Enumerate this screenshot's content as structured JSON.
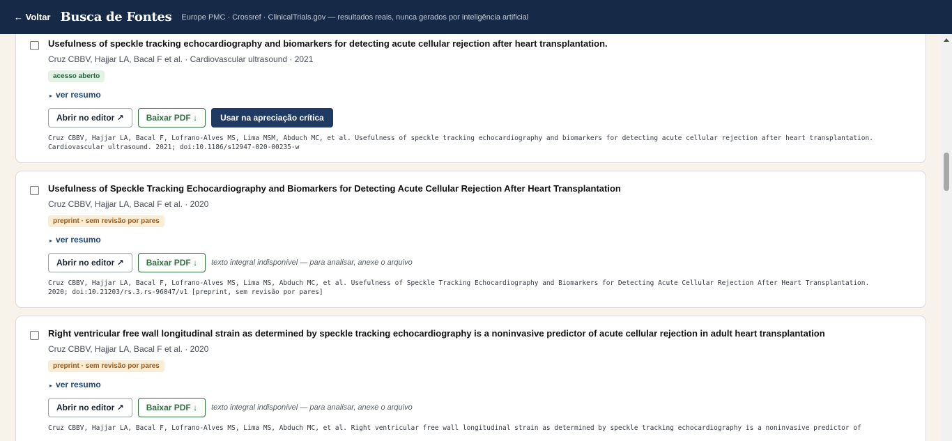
{
  "header": {
    "back_label": "← Voltar",
    "brand": "Busca de Fontes",
    "subtitle": "Europe PMC · Crossref · ClinicalTrials.gov — resultados reais, nunca gerados por inteligência artificial"
  },
  "common": {
    "ver_resumo": "ver resumo",
    "abrir_editor": "Abrir no editor ↗",
    "baixar_pdf": "Baixar PDF ↓",
    "usar_apreciacao": "Usar na apreciação crítica",
    "texto_indisponivel": "texto integral indisponível — para analisar, anexe o arquivo"
  },
  "results": [
    {
      "title": "Usefulness of speckle tracking echocardiography and biomarkers for detecting acute cellular rejection after heart transplantation.",
      "meta": "Cruz CBBV, Hajjar LA, Bacal F et al. · Cardiovascular ultrasound · 2021",
      "badge": "acesso aberto",
      "citation": "Cruz CBBV, Hajjar LA, Bacal F, Lofrano-Alves MS, Lima MSM, Abduch MC, et al. Usefulness of speckle tracking echocardiography and biomarkers for detecting acute cellular rejection after heart transplantation. Cardiovascular ultrasound. 2021; doi:10.1186/s12947-020-00235-w"
    },
    {
      "title": "Usefulness of Speckle Tracking Echocardiography and Biomarkers for Detecting Acute Cellular Rejection After Heart Transplantation",
      "meta": "Cruz CBBV, Hajjar LA, Bacal F et al. · 2020",
      "badge": "preprint · sem revisão por pares",
      "citation": "Cruz CBBV, Hajjar LA, Bacal F, Lofrano-Alves MS, Lima MS, Abduch MC, et al. Usefulness of Speckle Tracking Echocardiography and Biomarkers for Detecting Acute Cellular Rejection After Heart Transplantation. 2020; doi:10.21203/rs.3.rs-96047/v1 [preprint, sem revisão por pares]"
    },
    {
      "title": "Right ventricular free wall longitudinal strain as determined by speckle tracking echocardiography is a noninvasive predictor of acute cellular rejection in adult heart transplantation",
      "meta": "Cruz CBBV, Hajjar LA, Bacal F et al. · 2020",
      "badge": "preprint · sem revisão por pares",
      "citation": "Cruz CBBV, Hajjar LA, Bacal F, Lofrano-Alves MS, Lima MS, Abduch MC, et al. Right ventricular free wall longitudinal strain as determined by speckle tracking echocardiography is a noninvasive predictor of"
    }
  ]
}
